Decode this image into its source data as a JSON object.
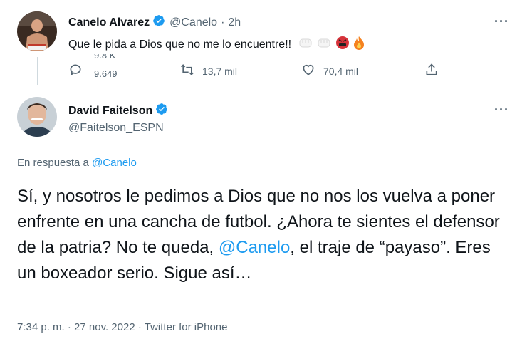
{
  "colors": {
    "accent": "#1d9bf0",
    "secondary": "#536471",
    "text": "#0f1419",
    "verified": "#1d9bf0"
  },
  "tweet1": {
    "name": "Canelo Alvarez",
    "handle": "@Canelo",
    "dot": "·",
    "time": "2h",
    "more": "···",
    "text": "Que le pida a Dios que no me lo encuentre!!",
    "emojis": [
      "fist-icon",
      "fist-icon",
      "angry-face-icon",
      "fire-icon"
    ],
    "actions": {
      "reply_count_top": "9.8 K",
      "reply_count": "9.649",
      "retweets": "13,7 mil",
      "likes": "70,4 mil"
    }
  },
  "tweet2": {
    "name": "David Faitelson",
    "handle": "@Faitelson_ESPN",
    "more": "···",
    "replying_prefix": "En respuesta a",
    "replying_to": "@Canelo",
    "text_part1": "Sí, y nosotros le pedimos a Dios que no nos los vuelva a poner enfrente en una cancha de futbol. ¿Ahora te sientes el defensor de la patria? No te queda, ",
    "mention": "@Canelo",
    "text_part2": ", el traje de “payaso”. Eres un boxeador serio. Sigue así…",
    "time": "7:34 p. m.",
    "date": "27 nov. 2022",
    "source": "Twitter for iPhone",
    "sep": "·"
  }
}
